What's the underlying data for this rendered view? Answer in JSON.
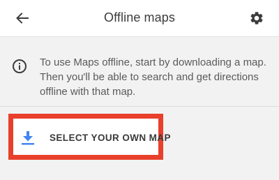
{
  "header": {
    "title": "Offline maps",
    "back_icon": "arrow-left-icon",
    "settings_icon": "gear-icon"
  },
  "info": {
    "icon": "info-icon",
    "text": "To use Maps offline, start by downloading a map. Then you'll be able to search and get directions offline with that map."
  },
  "select_map": {
    "icon": "download-icon",
    "label": "SELECT YOUR OWN MAP",
    "accent_color": "#4285f4",
    "highlight_color": "#e8402b"
  }
}
